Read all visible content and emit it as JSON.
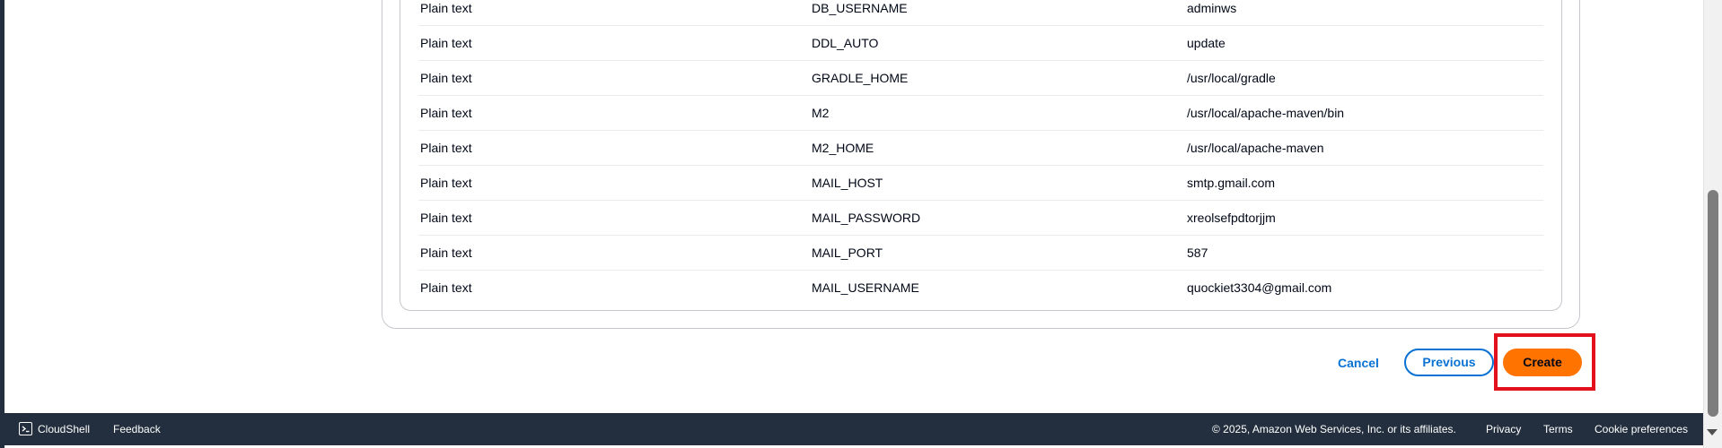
{
  "env_vars": [
    {
      "type": "Plain text",
      "name": "DB_USERNAME",
      "value": "adminws"
    },
    {
      "type": "Plain text",
      "name": "DDL_AUTO",
      "value": "update"
    },
    {
      "type": "Plain text",
      "name": "GRADLE_HOME",
      "value": "/usr/local/gradle"
    },
    {
      "type": "Plain text",
      "name": "M2",
      "value": "/usr/local/apache-maven/bin"
    },
    {
      "type": "Plain text",
      "name": "M2_HOME",
      "value": "/usr/local/apache-maven"
    },
    {
      "type": "Plain text",
      "name": "MAIL_HOST",
      "value": "smtp.gmail.com"
    },
    {
      "type": "Plain text",
      "name": "MAIL_PASSWORD",
      "value": "xreolsefpdtorjjm"
    },
    {
      "type": "Plain text",
      "name": "MAIL_PORT",
      "value": "587"
    },
    {
      "type": "Plain text",
      "name": "MAIL_USERNAME",
      "value": "quockiet3304@gmail.com"
    }
  ],
  "actions": {
    "cancel": "Cancel",
    "previous": "Previous",
    "create": "Create"
  },
  "footer": {
    "cloudshell": "CloudShell",
    "feedback": "Feedback",
    "copyright": "© 2025, Amazon Web Services, Inc. or its affiliates.",
    "privacy": "Privacy",
    "terms": "Terms",
    "cookies": "Cookie preferences"
  },
  "colors": {
    "primary_button": "#ff7300",
    "link": "#0972d3",
    "footer_bg": "#232f3e",
    "highlight": "#e3101e"
  }
}
